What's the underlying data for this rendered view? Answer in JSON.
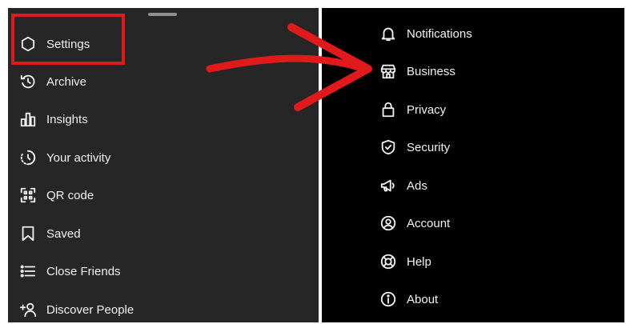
{
  "left_menu": {
    "items": [
      {
        "label": "Settings",
        "icon": "settings-icon"
      },
      {
        "label": "Archive",
        "icon": "archive-icon"
      },
      {
        "label": "Insights",
        "icon": "insights-icon"
      },
      {
        "label": "Your activity",
        "icon": "your-activity-icon"
      },
      {
        "label": "QR code",
        "icon": "qr-code-icon"
      },
      {
        "label": "Saved",
        "icon": "bookmark-icon"
      },
      {
        "label": "Close Friends",
        "icon": "list-icon"
      },
      {
        "label": "Discover People",
        "icon": "add-person-icon"
      }
    ]
  },
  "right_menu": {
    "items": [
      {
        "label": "Notifications",
        "icon": "bell-icon"
      },
      {
        "label": "Business",
        "icon": "storefront-icon"
      },
      {
        "label": "Privacy",
        "icon": "lock-icon"
      },
      {
        "label": "Security",
        "icon": "shield-check-icon"
      },
      {
        "label": "Ads",
        "icon": "megaphone-icon"
      },
      {
        "label": "Account",
        "icon": "account-circle-icon"
      },
      {
        "label": "Help",
        "icon": "lifebuoy-icon"
      },
      {
        "label": "About",
        "icon": "info-icon"
      }
    ]
  },
  "annotation": {
    "highlight_color": "#e01a1a",
    "arrow_color": "#e01a1a"
  }
}
